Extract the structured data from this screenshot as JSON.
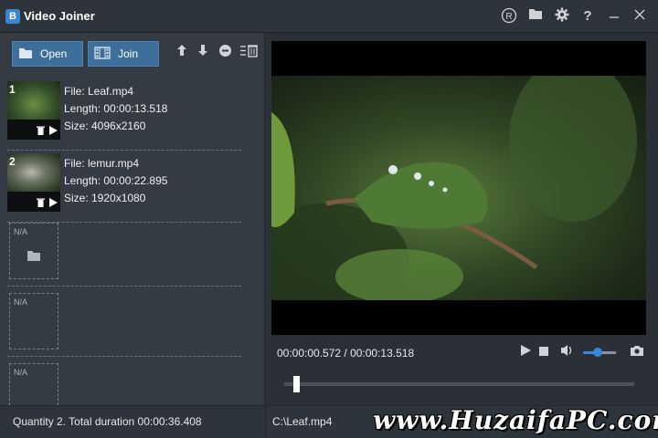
{
  "window": {
    "title": "Video Joiner",
    "logo_glyph": "B"
  },
  "titlebar_icons": [
    "registered-icon",
    "folder-icon",
    "gear-icon",
    "help-icon",
    "minimize-icon",
    "close-icon"
  ],
  "toolbar": {
    "open_label": "Open",
    "join_label": "Join",
    "tools": [
      "move-up-icon",
      "move-down-icon",
      "remove-icon",
      "clear-list-icon"
    ]
  },
  "files": [
    {
      "index": "1",
      "name": "File: Leaf.mp4",
      "length": "Length: 00:00:13.518",
      "size": "Size: 4096x2160"
    },
    {
      "index": "2",
      "name": "File: lemur.mp4",
      "length": "Length: 00:00:22.895",
      "size": "Size: 1920x1080"
    }
  ],
  "empty_slots": [
    {
      "label": "N/A",
      "has_folder": true
    },
    {
      "label": "N/A",
      "has_folder": false
    },
    {
      "label": "N/A",
      "has_folder": false
    }
  ],
  "player": {
    "current_time": "00:00:00.572",
    "total_time": "00:00:13.518",
    "timecode": "00:00:00.572 / 00:00:13.518",
    "volume_fraction": 0.45,
    "seek_fraction": 0.04
  },
  "status": {
    "summary": "Quantity 2. Total duration 00:00:36.408",
    "current_file": "C:\\Leaf.mp4"
  },
  "watermark": "www.HuzaifaPC.com",
  "colors": {
    "accent": "#3a86d4",
    "button": "#3e6f9c",
    "background": "#2b3037"
  }
}
